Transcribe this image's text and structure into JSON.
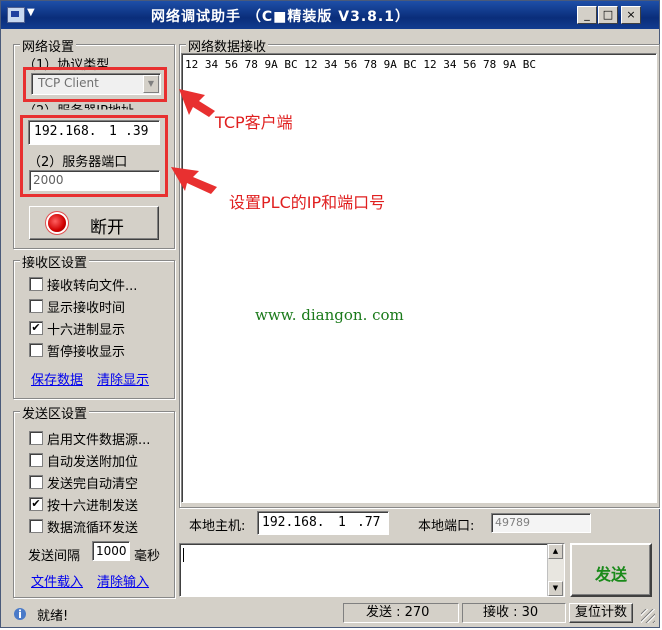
{
  "window": {
    "title": "网络调试助手 （C■精装版 V3.8.1）",
    "menu_arrow": "▼"
  },
  "titlebar_buttons": {
    "minimize": "_",
    "maximize": "□",
    "close": "×"
  },
  "network_settings": {
    "legend": "网络设置",
    "protocol_label": "（1）协议类型",
    "protocol_value": "TCP Client",
    "server_ip_label": "（2）服务器IP地址",
    "server_ip": [
      "192.168.",
      "1",
      ".39"
    ],
    "server_port_label": "（2）服务器端口",
    "server_port": "2000",
    "disconnect_button": "断开"
  },
  "receive_settings": {
    "legend": "接收区设置",
    "options": [
      {
        "label": "接收转向文件...",
        "checked": false
      },
      {
        "label": "显示接收时间",
        "checked": false
      },
      {
        "label": "十六进制显示",
        "checked": true
      },
      {
        "label": "暂停接收显示",
        "checked": false
      }
    ],
    "save_link": "保存数据",
    "clear_link": "清除显示"
  },
  "send_settings": {
    "legend": "发送区设置",
    "options": [
      {
        "label": "启用文件数据源...",
        "checked": false
      },
      {
        "label": "自动发送附加位",
        "checked": false
      },
      {
        "label": "发送完自动清空",
        "checked": false
      },
      {
        "label": "按十六进制发送",
        "checked": true
      },
      {
        "label": "数据流循环发送",
        "checked": false
      }
    ],
    "interval_label": "发送间隔",
    "interval_value": "1000",
    "interval_unit": "毫秒",
    "load_file_link": "文件载入",
    "clear_input_link": "清除输入"
  },
  "data_panel": {
    "legend": "网络数据接收",
    "received_text": "12 34 56 78 9A BC 12 34 56 78 9A BC 12 34 56 78 9A BC"
  },
  "local": {
    "host_label": "本地主机:",
    "host_ip": [
      "192.168.",
      "1",
      ".77"
    ],
    "port_label": "本地端口:",
    "port_value": "49789"
  },
  "send_button": "发送",
  "status": {
    "ready": "就绪!",
    "sent": "发送 : 270",
    "received": "接收 : 30",
    "reset_button": "复位计数"
  },
  "annotations": {
    "tcp_client": "TCP客户端",
    "set_plc": "设置PLC的IP和端口号",
    "watermark": "www. diangon. com"
  },
  "colors": {
    "annotation_red": "#e83030",
    "send_button_text": "#1a8a1a"
  }
}
